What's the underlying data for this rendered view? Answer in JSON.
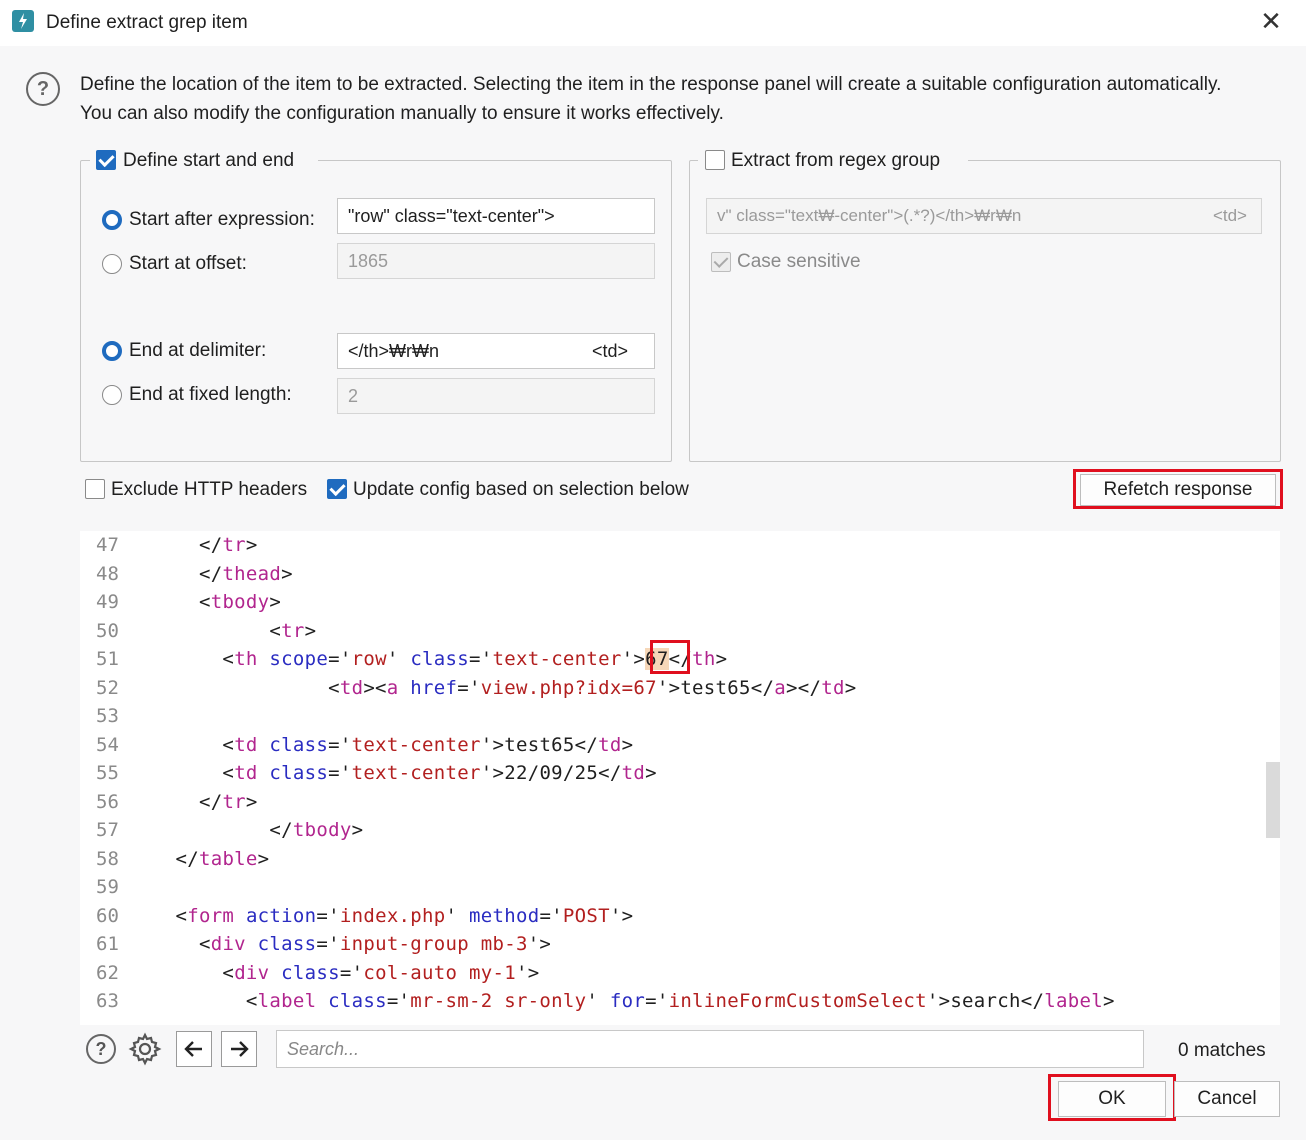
{
  "window": {
    "title": "Define extract grep item",
    "close_glyph": "✕",
    "app_icon": "burp-bolt-icon"
  },
  "description": "Define the location of the item to be extracted. Selecting the item in the response panel will create a suitable configuration automatically. You can also modify the configuration manually to ensure it works effectively.",
  "start_end": {
    "enabled": true,
    "legend": "Define start and end",
    "start_after_label": "Start after expression:",
    "start_after_selected": true,
    "start_after_value": "\"row\" class=\"text-center\">",
    "start_offset_label": "Start at offset:",
    "start_offset_value": "1865",
    "end_delimiter_label": "End at delimiter:",
    "end_delimiter_selected": true,
    "end_delimiter_value": "</th>₩r₩n",
    "end_delimiter_suffix": "<td>",
    "end_fixed_label": "End at fixed length:",
    "end_fixed_value": "2"
  },
  "regex_group": {
    "enabled": false,
    "legend": "Extract from regex group",
    "regex_value": "v\" class=\"text₩-center\">(.*?)</th>₩r₩n",
    "regex_suffix": "<td>",
    "case_sensitive_label": "Case sensitive",
    "case_sensitive_checked": true
  },
  "options": {
    "exclude_headers_label": "Exclude HTTP headers",
    "exclude_headers_checked": false,
    "update_config_label": "Update config based on selection below",
    "update_config_checked": true,
    "refetch_label": "Refetch response"
  },
  "code": {
    "line_numbers": [
      "47",
      "48",
      "49",
      "50",
      "51",
      "52",
      "53",
      "54",
      "55",
      "56",
      "57",
      "58",
      "59",
      "60",
      "61",
      "62",
      "63"
    ],
    "selected_value": "67"
  },
  "search": {
    "placeholder": "Search...",
    "matches": "0 matches"
  },
  "footer": {
    "ok_label": "OK",
    "cancel_label": "Cancel"
  },
  "colors": {
    "accent": "#1f6bbf",
    "highlight_box": "#e00f1e",
    "tag": "#b1258e",
    "attr": "#2a2cc1",
    "value": "#b21f1f"
  }
}
